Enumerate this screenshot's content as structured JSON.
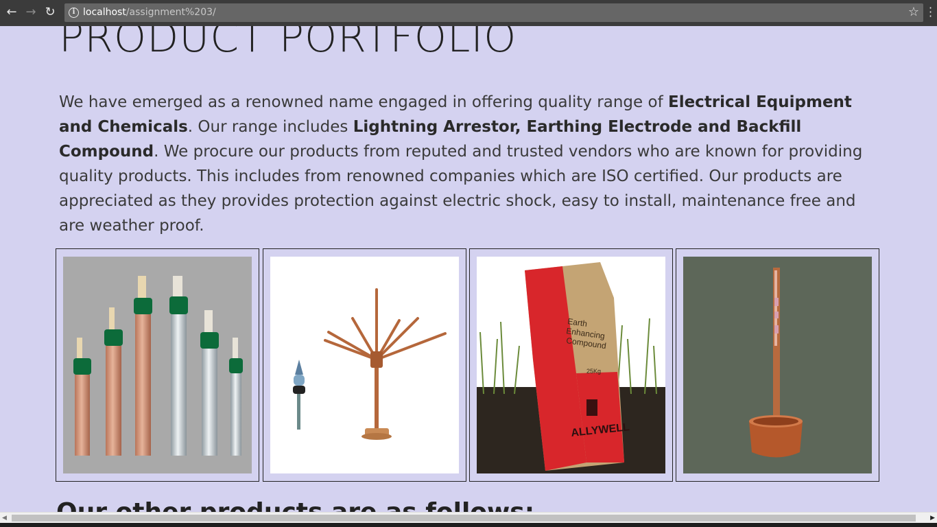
{
  "browser": {
    "url_host": "localhost",
    "url_path": "/assignment%203/",
    "icons": {
      "back": "back-arrow-icon",
      "forward": "forward-arrow-icon",
      "reload": "reload-icon",
      "info": "info-icon",
      "bookmark": "star-icon",
      "menu": "menu-dots-icon"
    }
  },
  "page": {
    "title": "PRODUCT PORTFOLIO",
    "intro": {
      "t1": "We have emerged as a renowned name engaged in offering quality range of ",
      "b1": "Electrical Equipment and Chemicals",
      "t2": ". Our range includes ",
      "b2": "Lightning Arrestor, Earthing Electrode and Backfill Compound",
      "t3": ". We procure our products from reputed and trusted vendors who are known for providing quality products. This includes from renowned companies which are ISO certified. Our products are appreciated as they provides protection against electric shock, easy to install, maintenance free and are weather proof."
    },
    "products": [
      {
        "name": "earthing-electrodes"
      },
      {
        "name": "lightning-arrestor"
      },
      {
        "name": "backfill-compound-bag",
        "bag_text_1": "Earth",
        "bag_text_2": "Enhancing",
        "bag_text_3": "Compound",
        "bag_weight": "25Kg",
        "bag_brand": "ALLYWELL"
      },
      {
        "name": "earthing-rod-with-cup"
      }
    ],
    "subheading": "Our other products are as follows:"
  },
  "colors": {
    "page_bg": "#d4d2f0",
    "chrome_bg": "#3b3b3b",
    "copper": "#c47a4e",
    "electrode_cap": "#0c6b3a",
    "bag_red": "#d8262b"
  }
}
